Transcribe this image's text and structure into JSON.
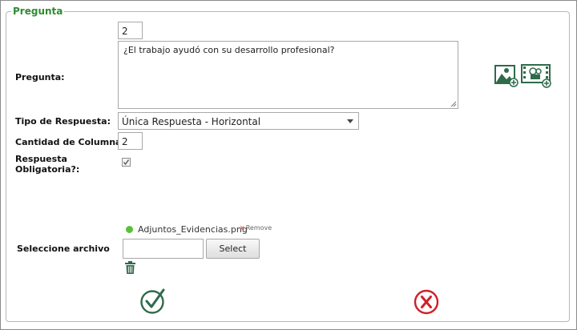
{
  "form": {
    "legend": "Pregunta",
    "number_value": "2",
    "pregunta_label": "Pregunta:",
    "pregunta_text": "¿El trabajo ayudó con su desarrollo profesional?",
    "tipo_label": "Tipo de Respuesta:",
    "tipo_value": "Única Respuesta - Horizontal",
    "columnas_label": "Cantidad de Columnas:",
    "columnas_value": "2",
    "obligatoria_label_1": "Respuesta",
    "obligatoria_label_2": "Obligatoria?:",
    "obligatoria_checked": true,
    "archivo_label": "Seleccione archivo",
    "file_name": "Adjuntos_Evidencias.png",
    "remove_label": "Remove",
    "file_input_value": "",
    "select_button": "Select"
  },
  "icons": {
    "add_image": "add-image-icon",
    "add_video": "add-video-icon",
    "delete": "trash-icon",
    "confirm": "check-circle-icon",
    "cancel": "x-circle-icon"
  },
  "colors": {
    "legend": "#2e8b2e",
    "confirm": "#2f6b4a",
    "cancel": "#d0202a",
    "file_ok": "#5bbf3c"
  }
}
